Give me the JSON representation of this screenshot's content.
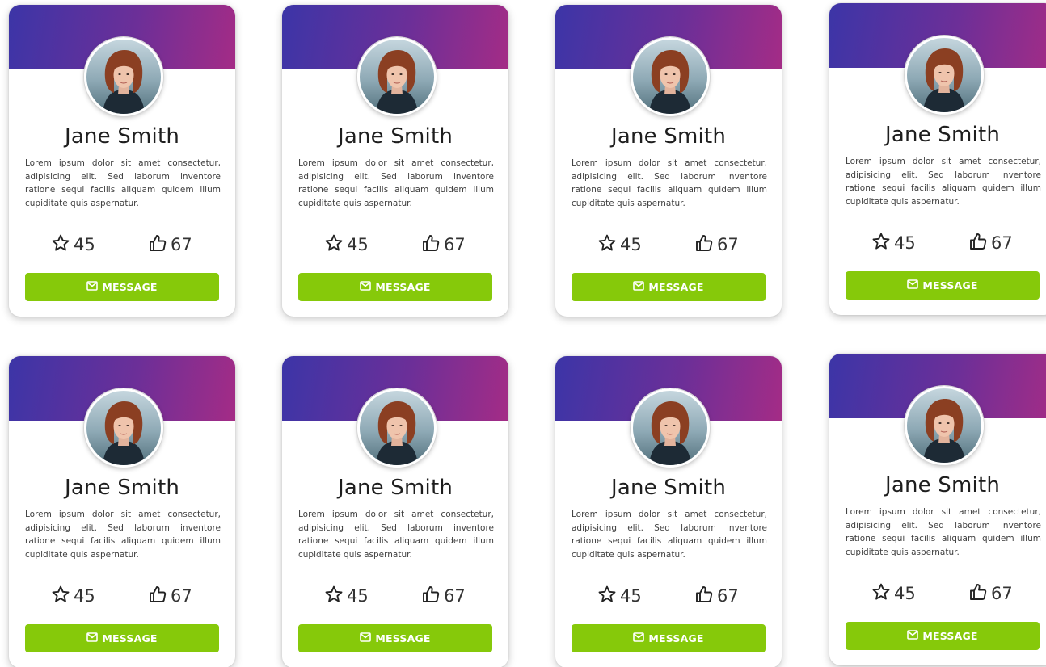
{
  "cards": [
    {
      "name": "Jane Smith",
      "bio": "Lorem ipsum dolor sit amet consectetur, adipisicing elit. Sed laborum inventore ratione sequi facilis aliquam quidem illum cupiditate quis aspernatur.",
      "stars": "45",
      "likes": "67",
      "button_label": "MESSAGE"
    },
    {
      "name": "Jane Smith",
      "bio": "Lorem ipsum dolor sit amet consectetur, adipisicing elit. Sed laborum inventore ratione sequi facilis aliquam quidem illum cupiditate quis aspernatur.",
      "stars": "45",
      "likes": "67",
      "button_label": "MESSAGE"
    },
    {
      "name": "Jane Smith",
      "bio": "Lorem ipsum dolor sit amet consectetur, adipisicing elit. Sed laborum inventore ratione sequi facilis aliquam quidem illum cupiditate quis aspernatur.",
      "stars": "45",
      "likes": "67",
      "button_label": "MESSAGE"
    },
    {
      "name": "Jane Smith",
      "bio": "Lorem ipsum dolor sit amet consectetur, adipisicing elit. Sed laborum inventore ratione sequi facilis aliquam quidem illum cupiditate quis aspernatur.",
      "stars": "45",
      "likes": "67",
      "button_label": "MESSAGE"
    },
    {
      "name": "Jane Smith",
      "bio": "Lorem ipsum dolor sit amet consectetur, adipisicing elit. Sed laborum inventore ratione sequi facilis aliquam quidem illum cupiditate quis aspernatur.",
      "stars": "45",
      "likes": "67",
      "button_label": "MESSAGE"
    },
    {
      "name": "Jane Smith",
      "bio": "Lorem ipsum dolor sit amet consectetur, adipisicing elit. Sed laborum inventore ratione sequi facilis aliquam quidem illum cupiditate quis aspernatur.",
      "stars": "45",
      "likes": "67",
      "button_label": "MESSAGE"
    },
    {
      "name": "Jane Smith",
      "bio": "Lorem ipsum dolor sit amet consectetur, adipisicing elit. Sed laborum inventore ratione sequi facilis aliquam quidem illum cupiditate quis aspernatur.",
      "stars": "45",
      "likes": "67",
      "button_label": "MESSAGE"
    },
    {
      "name": "Jane Smith",
      "bio": "Lorem ipsum dolor sit amet consectetur, adipisicing elit. Sed laborum inventore ratione sequi facilis aliquam quidem illum cupiditate quis aspernatur.",
      "stars": "45",
      "likes": "67",
      "button_label": "MESSAGE"
    }
  ],
  "icons": {
    "stars": "star-outline-icon",
    "likes": "thumbs-up-outline-icon",
    "button": "envelope-icon",
    "avatar": "profile-photo"
  },
  "colors": {
    "header_gradient_start": "#3c35a7",
    "header_gradient_end": "#a42c86",
    "button": "#86c90a",
    "name_text": "#1e1e1e"
  }
}
